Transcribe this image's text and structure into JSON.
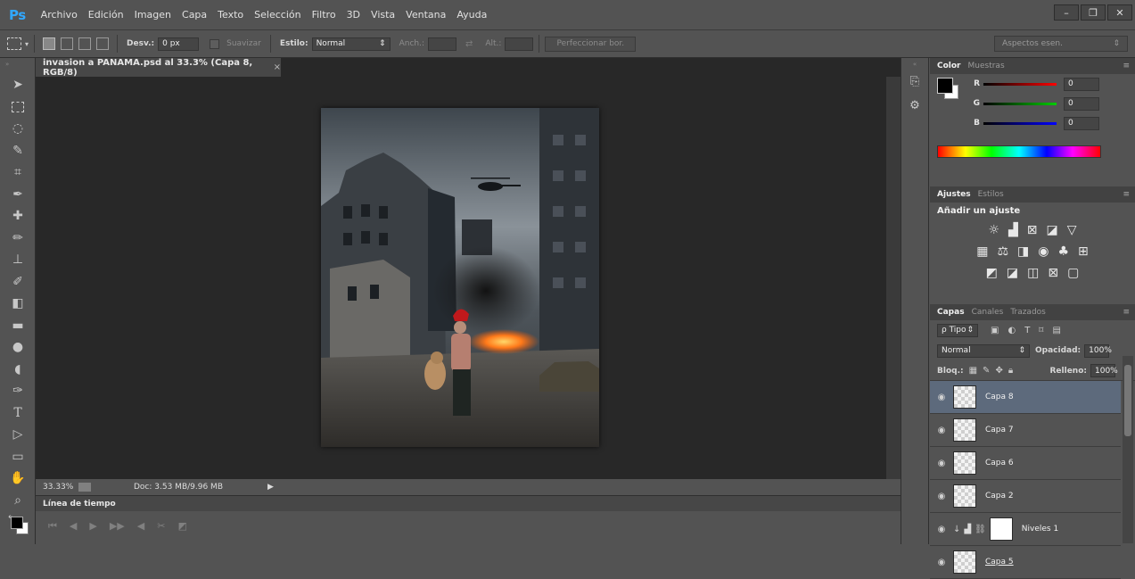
{
  "app": {
    "logo": "Ps"
  },
  "menu": [
    "Archivo",
    "Edición",
    "Imagen",
    "Capa",
    "Texto",
    "Selección",
    "Filtro",
    "3D",
    "Vista",
    "Ventana",
    "Ayuda"
  ],
  "window_controls": [
    "–",
    "❐",
    "✕"
  ],
  "options": {
    "feather_label": "Desv.:",
    "feather_value": "0 px",
    "antialias_label": "Suavizar",
    "style_label": "Estilo:",
    "style_value": "Normal",
    "width_label": "Anch.:",
    "height_label": "Alt.:",
    "refine_button": "Perfeccionar bor.",
    "workspace": "Aspectos esen."
  },
  "document": {
    "tab_title": "invasion a PANAMA.psd al 33.3% (Capa 8, RGB/8)",
    "tab_close": "×",
    "zoom": "33.33%",
    "doc_info": "Doc: 3.53 MB/9.96 MB"
  },
  "timeline": {
    "title": "Línea de tiempo"
  },
  "color_panel": {
    "tabs": [
      "Color",
      "Muestras"
    ],
    "channels": [
      {
        "label": "R",
        "value": "0",
        "color": "#ff0000"
      },
      {
        "label": "G",
        "value": "0",
        "color": "#00cc00"
      },
      {
        "label": "B",
        "value": "0",
        "color": "#0000ff"
      }
    ]
  },
  "adjust_panel": {
    "tabs": [
      "Ajustes",
      "Estilos"
    ],
    "heading": "Añadir un ajuste"
  },
  "layers_panel": {
    "tabs": [
      "Capas",
      "Canales",
      "Trazados"
    ],
    "filter": "ρ Tipo",
    "blend_mode": "Normal",
    "opacity_label": "Opacidad:",
    "opacity_value": "100%",
    "lock_label": "Bloq.:",
    "fill_label": "Relleno:",
    "fill_value": "100%",
    "layers": [
      {
        "name": "Capa 8",
        "selected": true
      },
      {
        "name": "Capa 7",
        "selected": false
      },
      {
        "name": "Capa 6",
        "selected": false
      },
      {
        "name": "Capa 2",
        "selected": false
      },
      {
        "name": "Niveles 1",
        "selected": false
      },
      {
        "name": "Capa 5",
        "selected": false
      }
    ]
  }
}
